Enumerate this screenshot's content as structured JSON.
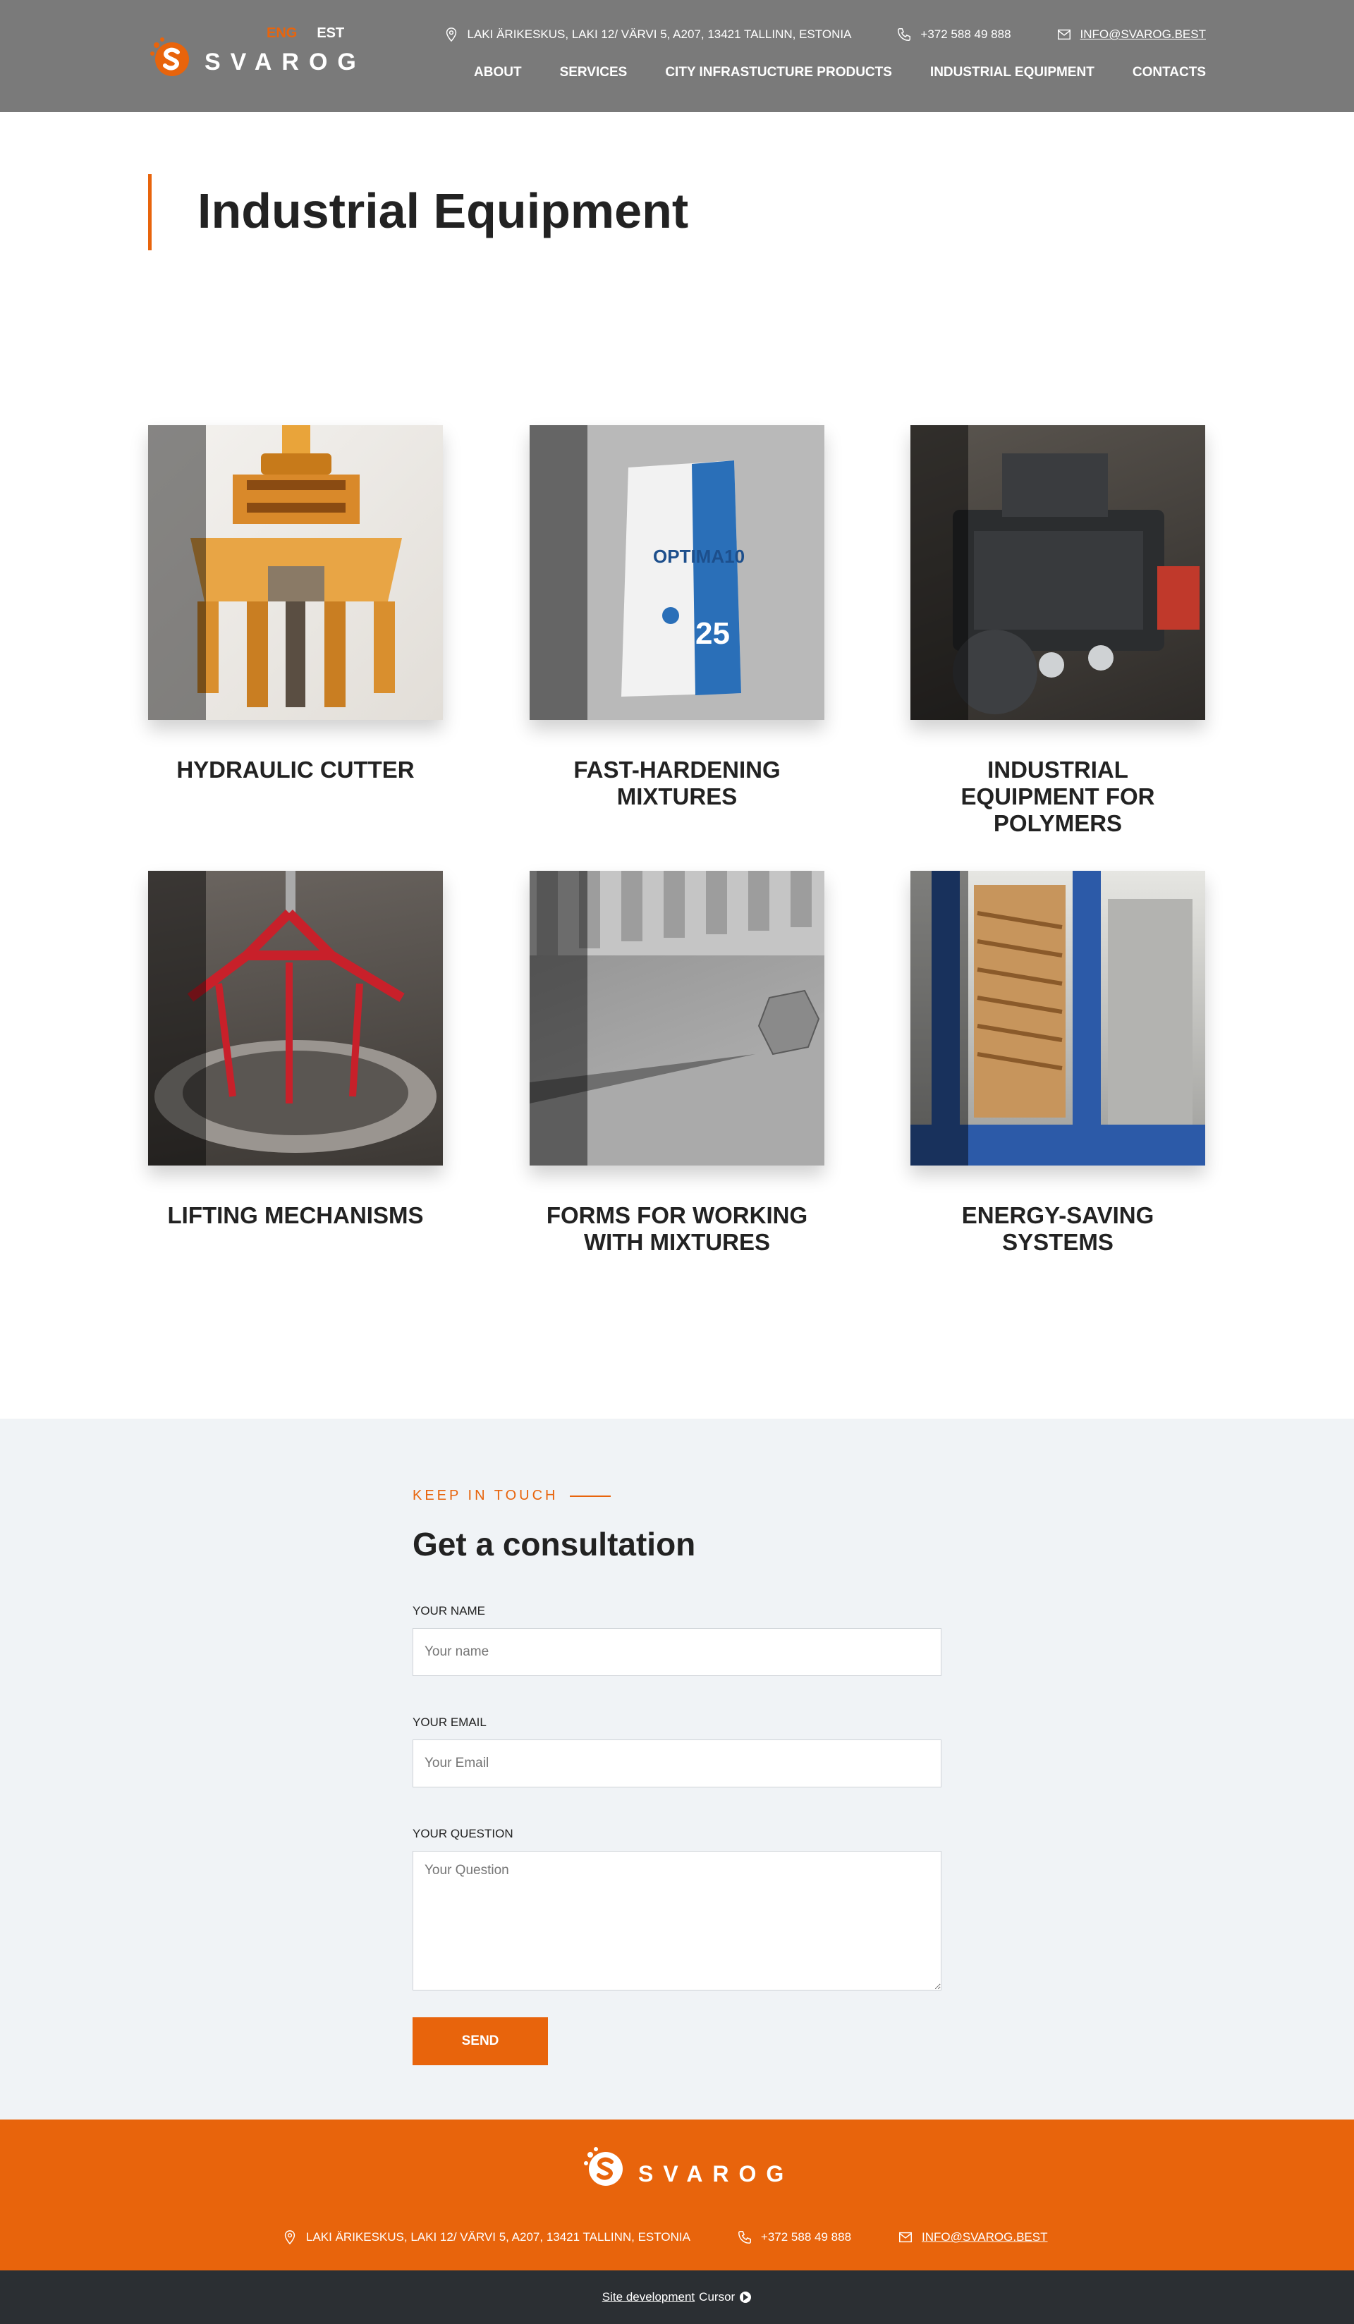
{
  "header": {
    "logo_text": "SVAROG",
    "langs": [
      "ENG",
      "EST"
    ],
    "address": "LAKI ÄRIKESKUS, LAKI 12/ VÄRVI 5, A207, 13421 TALLINN, ESTONIA",
    "phone": "+372 588 49 888",
    "email": "INFO@SVAROG.BEST",
    "nav": [
      "ABOUT",
      "SERVICES",
      "CITY INFRASTUCTURE PRODUCTS",
      "INDUSTRIAL EQUIPMENT",
      "CONTACTS"
    ]
  },
  "page_title": "Industrial Equipment",
  "products": [
    {
      "title": "HYDRAULIC CUTTER",
      "image": "hydraulic-cutter"
    },
    {
      "title": "FAST-HARDENING MIXTURES",
      "image": "cement-bag"
    },
    {
      "title": "INDUSTRIAL EQUIPMENT FOR POLYMERS",
      "image": "polymer-machine"
    },
    {
      "title": "LIFTING MECHANISMS",
      "image": "lifting-grab"
    },
    {
      "title": "FORMS FOR WORKING WITH MIXTURES",
      "image": "forms"
    },
    {
      "title": "ENERGY-SAVING SYSTEMS",
      "image": "energy-system"
    }
  ],
  "consult": {
    "kicker": "KEEP IN TOUCH",
    "title": "Get a consultation",
    "name_label": "YOUR NAME",
    "name_placeholder": "Your name",
    "email_label": "YOUR EMAIL",
    "email_placeholder": "Your Email",
    "question_label": "YOUR QUESTION",
    "question_placeholder": "Your Question",
    "send_label": "SEND"
  },
  "footer": {
    "logo_text": "SVAROG",
    "address": "LAKI ÄRIKESKUS, LAKI 12/ VÄRVI 5, A207, 13421 TALLINN, ESTONIA",
    "phone": "+372 588 49 888",
    "email": "INFO@SVAROG.BEST",
    "dev_link": "Site development",
    "dev_name": "Cursor"
  },
  "colors": {
    "accent": "#e8640c",
    "header_bg": "#7a7a7a",
    "consult_bg": "#f0f3f6",
    "bottom_bar": "#2b2f33"
  }
}
